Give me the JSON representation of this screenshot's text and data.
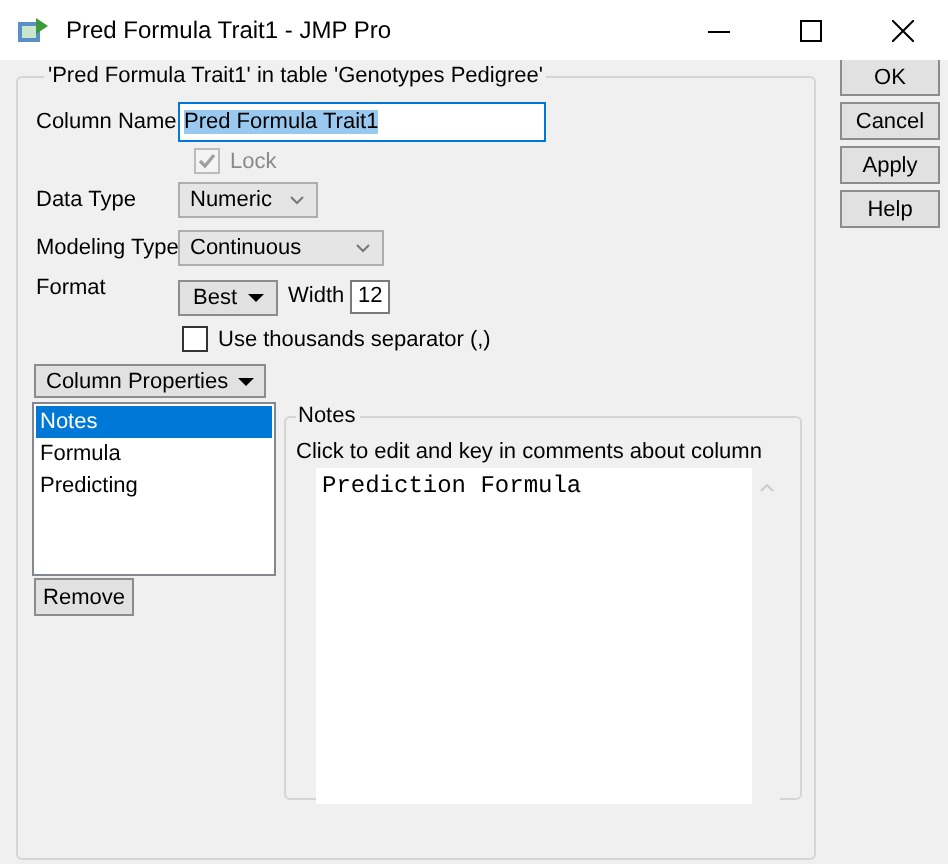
{
  "window": {
    "title": "Pred Formula Trait1 - JMP Pro"
  },
  "group_title": "'Pred Formula Trait1' in table 'Genotypes Pedigree'",
  "column_name": {
    "label": "Column Name",
    "value": "Pred Formula Trait1",
    "selected": true
  },
  "lock": {
    "label": "Lock",
    "checked": true,
    "disabled": true
  },
  "data_type": {
    "label": "Data Type",
    "value": "Numeric"
  },
  "modeling_type": {
    "label": "Modeling Type",
    "value": "Continuous"
  },
  "format": {
    "label": "Format",
    "button": "Best",
    "width_label": "Width",
    "width_value": "12"
  },
  "thousands": {
    "label": "Use thousands separator (,)",
    "checked": false
  },
  "column_properties": {
    "button": "Column Properties",
    "remove": "Remove",
    "items": [
      {
        "label": "Notes",
        "selected": true
      },
      {
        "label": "Formula",
        "selected": false
      },
      {
        "label": "Predicting",
        "selected": false
      }
    ]
  },
  "notes": {
    "title": "Notes",
    "hint": "Click to edit and key in comments about column",
    "value": "Prediction Formula"
  },
  "buttons": [
    "OK",
    "Cancel",
    "Apply",
    "Help"
  ]
}
